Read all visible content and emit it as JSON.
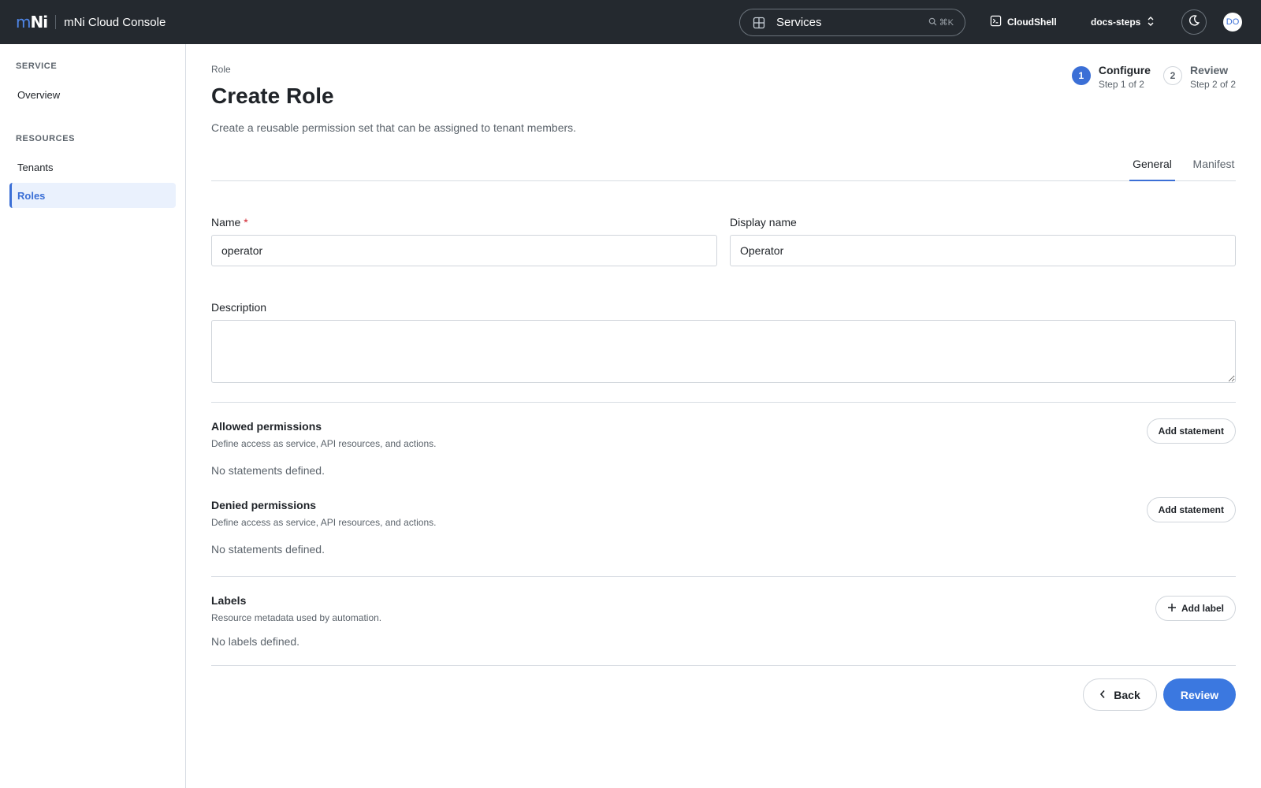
{
  "header": {
    "logo_m": "m",
    "logo_ni": "Ni",
    "app_title": "mNi Cloud Console",
    "search_label": "Services",
    "search_shortcut": "⌘K",
    "cloudshell_label": "CloudShell",
    "project_label": "docs-steps",
    "avatar_initials": "DO"
  },
  "sidebar": {
    "sections": [
      {
        "heading": "SERVICE",
        "items": [
          {
            "label": "Overview"
          }
        ]
      },
      {
        "heading": "RESOURCES",
        "items": [
          {
            "label": "Tenants"
          },
          {
            "label": "Roles",
            "active": true
          }
        ]
      }
    ]
  },
  "page": {
    "breadcrumb": "Role",
    "title": "Create Role",
    "subtitle": "Create a reusable permission set that can be assigned to tenant members."
  },
  "stepper": {
    "steps": [
      {
        "number": "1",
        "title": "Configure",
        "subtitle": "Step 1 of 2",
        "active": true
      },
      {
        "number": "2",
        "title": "Review",
        "subtitle": "Step 2 of 2",
        "active": false
      }
    ]
  },
  "tabs": [
    {
      "label": "General",
      "active": true
    },
    {
      "label": "Manifest",
      "active": false
    }
  ],
  "form": {
    "name_label": "Name",
    "name_required_mark": "*",
    "name_value": "operator",
    "display_name_label": "Display name",
    "display_name_value": "Operator",
    "description_label": "Description",
    "description_value": ""
  },
  "allowed": {
    "title": "Allowed permissions",
    "description": "Define access as service, API resources, and actions.",
    "empty_text": "No statements defined.",
    "button": "Add statement"
  },
  "denied": {
    "title": "Denied permissions",
    "description": "Define access as service, API resources, and actions.",
    "empty_text": "No statements defined.",
    "button": "Add statement"
  },
  "labels": {
    "title": "Labels",
    "description": "Resource metadata used by automation.",
    "empty_text": "No labels defined.",
    "button": "Add label"
  },
  "footer": {
    "back_label": "Back",
    "review_label": "Review"
  },
  "colors": {
    "accent": "#3b6fd6",
    "topbar": "#24292f",
    "required": "#d1242f"
  }
}
